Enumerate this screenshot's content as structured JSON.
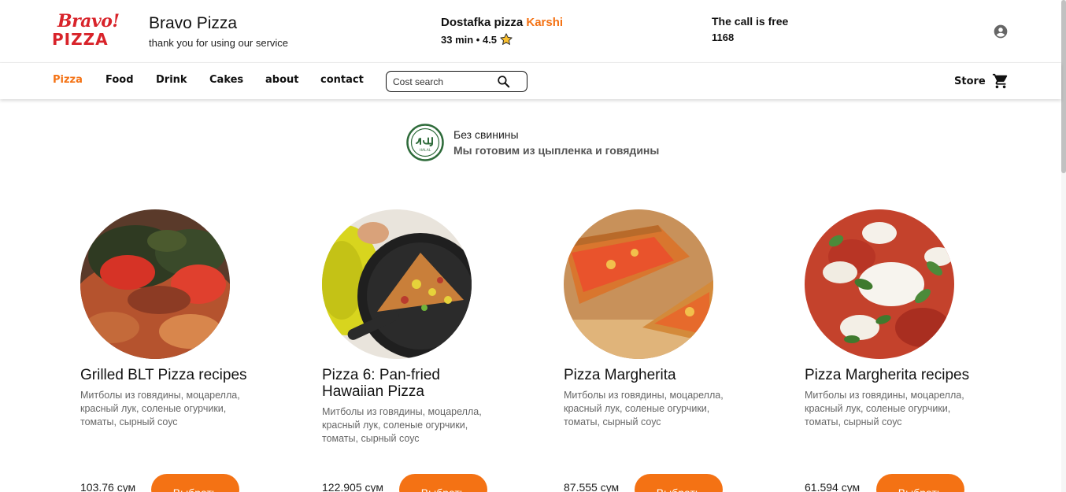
{
  "header": {
    "logo_top": "Bravo!",
    "logo_bottom": "PIZZA",
    "brand_title": "Bravo Pizza",
    "brand_subtitle": "thank you for using our service",
    "delivery_label": "Dostafka pizza",
    "delivery_city": "Karshi",
    "delivery_info": "33 min • 4.5",
    "call_label": "The call is free",
    "call_number": "1168",
    "account_icon": "account-circle-icon"
  },
  "nav": {
    "items": [
      {
        "label": "Pizza",
        "active": true
      },
      {
        "label": "Food",
        "active": false
      },
      {
        "label": "Drink",
        "active": false
      },
      {
        "label": "Cakes",
        "active": false
      },
      {
        "label": "about",
        "active": false
      },
      {
        "label": "contact",
        "active": false
      }
    ],
    "search_placeholder": "Cost search",
    "store_label": "Store"
  },
  "halal": {
    "line1": "Без свинины",
    "line2": "Мы готовим из цыпленка и говядины",
    "badge_text": "HALAL"
  },
  "products": [
    {
      "name": "Grilled BLT Pizza recipes",
      "description": "Митболы из говядины, моцарелла, красный лук, соленые огурчики, томаты, сырный соус",
      "price": "103.76 сум",
      "button": "Выбрать"
    },
    {
      "name": "Pizza 6: Pan-fried Hawaiian Pizza",
      "description": "Митболы из говядины, моцарелла, красный лук, соленые огурчики, томаты, сырный соус",
      "price": "122.905 сум",
      "button": "Выбрать"
    },
    {
      "name": "Pizza Margherita",
      "description": "Митболы из говядины, моцарелла, красный лук, соленые огурчики, томаты, сырный соус",
      "price": "87.555 сум",
      "button": "Выбрать"
    },
    {
      "name": "Pizza Margherita recipes",
      "description": "Митболы из говядины, моцарелла, красный лук, соленые огурчики, томаты, сырный соус",
      "price": "61.594 сум",
      "button": "Выбрать"
    }
  ],
  "colors": {
    "accent": "#f47214",
    "logo_red": "#d8232a",
    "halal_green": "#2e6b3a"
  }
}
